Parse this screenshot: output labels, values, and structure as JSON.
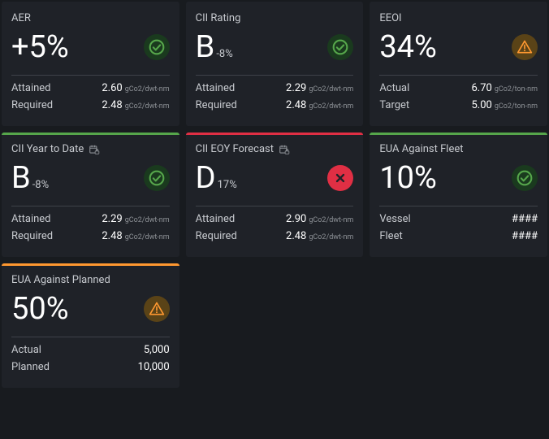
{
  "cards": [
    {
      "title": "AER",
      "stripe": "none",
      "status": "ok",
      "big": "+5%",
      "sub": "",
      "row1_label": "Attained",
      "row1_val": "2.60",
      "row1_unit": "gCo2/dwt-nm",
      "row2_label": "Required",
      "row2_val": "2.48",
      "row2_unit": "gCo2/dwt-nm"
    },
    {
      "title": "CII Rating",
      "stripe": "none",
      "status": "ok",
      "big": "B",
      "sub": "-8%",
      "row1_label": "Attained",
      "row1_val": "2.29",
      "row1_unit": "gCo2/dwt-nm",
      "row2_label": "Required",
      "row2_val": "2.48",
      "row2_unit": "gCo2/dwt-nm"
    },
    {
      "title": "EEOI",
      "stripe": "none",
      "status": "warn",
      "big": "34%",
      "sub": "",
      "row1_label": "Actual",
      "row1_val": "6.70",
      "row1_unit": "gCo2/ton-nm",
      "row2_label": "Target",
      "row2_val": "5.00",
      "row2_unit": "gCo2/ton-nm"
    },
    {
      "title": "CII Year to Date",
      "stripe": "green",
      "status": "ok",
      "icon": "calendar-lock",
      "big": "B",
      "sub": "-8%",
      "row1_label": "Attained",
      "row1_val": "2.29",
      "row1_unit": "gCo2/dwt-nm",
      "row2_label": "Required",
      "row2_val": "2.48",
      "row2_unit": "gCo2/dwt-nm"
    },
    {
      "title": "CII EOY Forecast",
      "stripe": "red",
      "status": "err",
      "icon": "calendar-lock",
      "big": "D",
      "sub": "17%",
      "row1_label": "Attained",
      "row1_val": "2.90",
      "row1_unit": "gCo2/dwt-nm",
      "row2_label": "Required",
      "row2_val": "2.48",
      "row2_unit": "gCo2/dwt-nm"
    },
    {
      "title": "EUA Against Fleet",
      "stripe": "green",
      "status": "ok",
      "big": "10%",
      "sub": "",
      "row1_label": "Vessel",
      "row1_val": "####",
      "row1_unit": "",
      "row2_label": "Fleet",
      "row2_val": "####",
      "row2_unit": ""
    },
    {
      "title": "EUA Against Planned",
      "stripe": "orange",
      "status": "warn",
      "big": "50%",
      "sub": "",
      "row1_label": "Actual",
      "row1_val": "5,000",
      "row1_unit": "",
      "row2_label": "Planned",
      "row2_val": "10,000",
      "row2_unit": ""
    }
  ],
  "chart_data": [
    {
      "type": "table",
      "title": "AER",
      "rows": [
        [
          "Attained",
          "2.60",
          "gCo2/dwt-nm"
        ],
        [
          "Required",
          "2.48",
          "gCo2/dwt-nm"
        ]
      ],
      "headline": "+5%",
      "status": "ok"
    },
    {
      "type": "table",
      "title": "CII Rating",
      "rows": [
        [
          "Attained",
          "2.29",
          "gCo2/dwt-nm"
        ],
        [
          "Required",
          "2.48",
          "gCo2/dwt-nm"
        ]
      ],
      "headline": "B -8%",
      "status": "ok"
    },
    {
      "type": "table",
      "title": "EEOI",
      "rows": [
        [
          "Actual",
          "6.70",
          "gCo2/ton-nm"
        ],
        [
          "Target",
          "5.00",
          "gCo2/ton-nm"
        ]
      ],
      "headline": "34%",
      "status": "warn"
    },
    {
      "type": "table",
      "title": "CII Year to Date",
      "rows": [
        [
          "Attained",
          "2.29",
          "gCo2/dwt-nm"
        ],
        [
          "Required",
          "2.48",
          "gCo2/dwt-nm"
        ]
      ],
      "headline": "B -8%",
      "status": "ok"
    },
    {
      "type": "table",
      "title": "CII EOY Forecast",
      "rows": [
        [
          "Attained",
          "2.90",
          "gCo2/dwt-nm"
        ],
        [
          "Required",
          "2.48",
          "gCo2/dwt-nm"
        ]
      ],
      "headline": "D 17%",
      "status": "err"
    },
    {
      "type": "table",
      "title": "EUA Against Fleet",
      "rows": [
        [
          "Vessel",
          "####",
          ""
        ],
        [
          "Fleet",
          "####",
          ""
        ]
      ],
      "headline": "10%",
      "status": "ok"
    },
    {
      "type": "table",
      "title": "EUA Against Planned",
      "rows": [
        [
          "Actual",
          "5,000",
          ""
        ],
        [
          "Planned",
          "10,000",
          ""
        ]
      ],
      "headline": "50%",
      "status": "warn"
    }
  ]
}
